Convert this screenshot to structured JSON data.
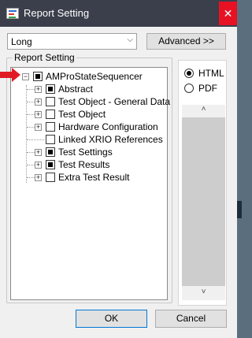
{
  "window": {
    "title": "Report Setting",
    "close_glyph": "✕"
  },
  "toolbar": {
    "template_select": {
      "value": "Long",
      "chevron": "⌵"
    },
    "advanced_label": "Advanced >>"
  },
  "group": {
    "label": "Report Setting"
  },
  "tree": {
    "root": {
      "label": "AMProStateSequencer",
      "state": "partial",
      "expander": "−"
    },
    "children": [
      {
        "label": "Abstract",
        "state": "partial",
        "expander": "+"
      },
      {
        "label": "Test Object - General Data",
        "state": "unchecked",
        "expander": "+"
      },
      {
        "label": "Test Object",
        "state": "unchecked",
        "expander": "+"
      },
      {
        "label": "Hardware Configuration",
        "state": "unchecked",
        "expander": "+"
      },
      {
        "label": "Linked XRIO References",
        "state": "unchecked",
        "expander": ""
      },
      {
        "label": "Test Settings",
        "state": "partial",
        "expander": "+"
      },
      {
        "label": "Test Results",
        "state": "partial",
        "expander": "+"
      },
      {
        "label": "Extra Test Result",
        "state": "unchecked",
        "expander": "+"
      }
    ]
  },
  "format": {
    "options": [
      {
        "label": "HTML",
        "selected": true
      },
      {
        "label": "PDF",
        "selected": false
      }
    ]
  },
  "scroll": {
    "up_glyph": "˄",
    "down_glyph": "˅"
  },
  "footer": {
    "ok_label": "OK",
    "cancel_label": "Cancel"
  },
  "annotation": {
    "arrow_color": "#e01b24"
  }
}
